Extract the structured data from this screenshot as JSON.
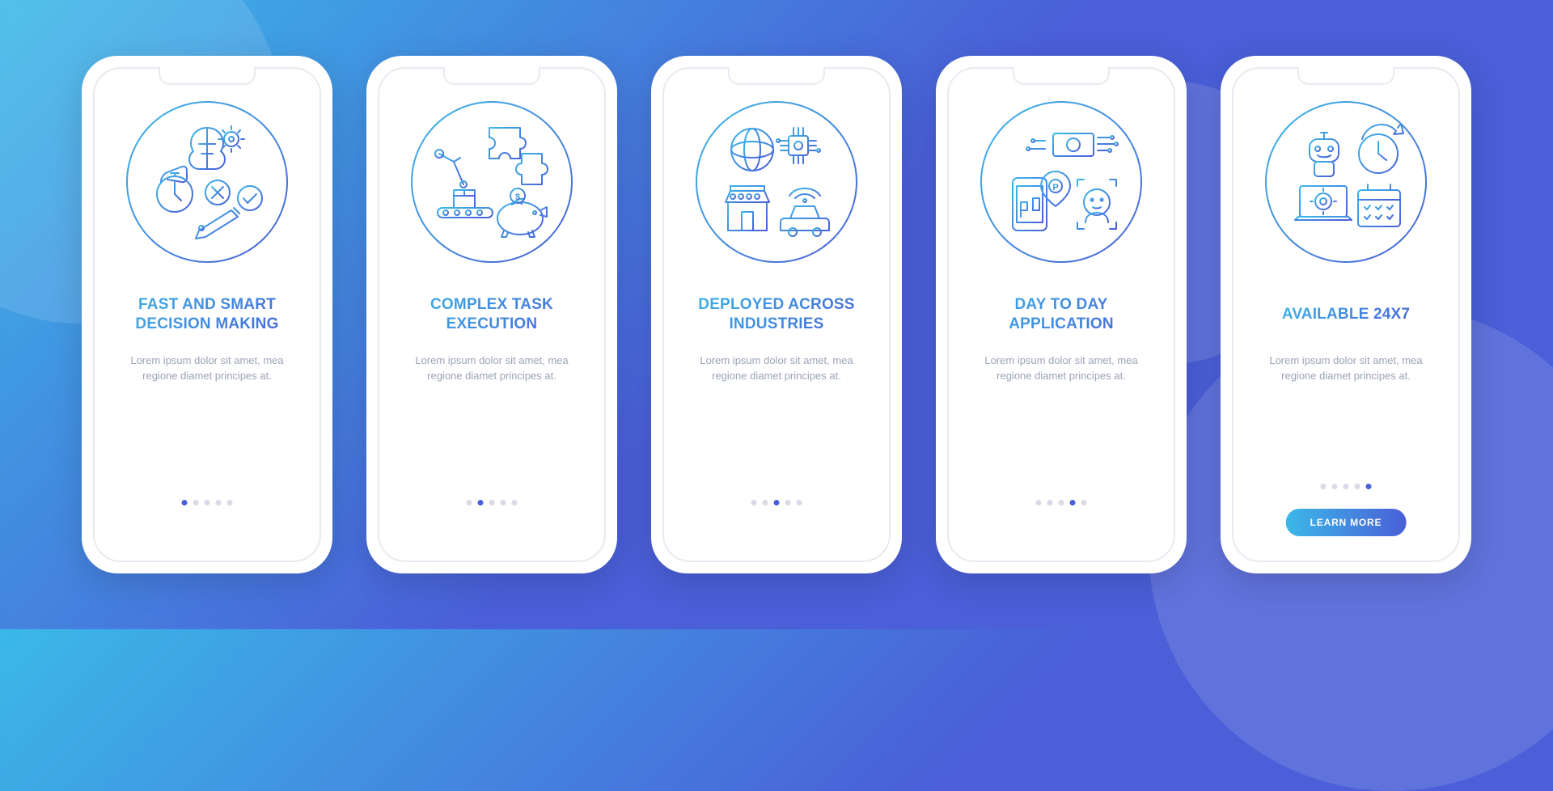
{
  "screens": [
    {
      "icon_name": "decision-making-icon",
      "title": "FAST AND SMART DECISION MAKING",
      "description": "Lorem ipsum dolor sit amet, mea regione diamet principes at.",
      "active_dot_index": 0
    },
    {
      "icon_name": "task-execution-icon",
      "title": "COMPLEX TASK EXECUTION",
      "description": "Lorem ipsum dolor sit amet, mea regione diamet principes at.",
      "active_dot_index": 1
    },
    {
      "icon_name": "industries-icon",
      "title": "DEPLOYED ACROSS INDUSTRIES",
      "description": "Lorem ipsum dolor sit amet, mea regione diamet principes at.",
      "active_dot_index": 2
    },
    {
      "icon_name": "daily-application-icon",
      "title": "DAY TO DAY APPLICATION",
      "description": "Lorem ipsum dolor sit amet, mea regione diamet principes at.",
      "active_dot_index": 3
    },
    {
      "icon_name": "available-247-icon",
      "title": "AVAILABLE 24X7",
      "description": "Lorem ipsum dolor sit amet, mea regione diamet principes at.",
      "active_dot_index": 4,
      "button_label": "LEARN MORE"
    }
  ],
  "total_dots": 5
}
